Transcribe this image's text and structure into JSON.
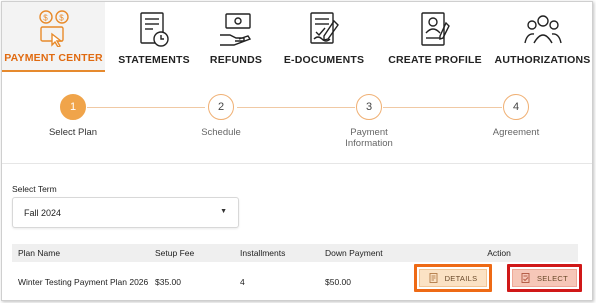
{
  "nav": {
    "items": [
      {
        "label": "PAYMENT CENTER",
        "icon": "payment-center-icon",
        "active": true
      },
      {
        "label": "STATEMENTS",
        "icon": "statements-icon"
      },
      {
        "label": "REFUNDS",
        "icon": "refunds-icon"
      },
      {
        "label": "E-DOCUMENTS",
        "icon": "e-documents-icon"
      },
      {
        "label": "CREATE PROFILE",
        "icon": "create-profile-icon"
      },
      {
        "label": "AUTHORIZATIONS",
        "icon": "authorizations-icon"
      }
    ]
  },
  "stepper": {
    "steps": [
      {
        "number": "1",
        "label": "Select Plan",
        "active": true
      },
      {
        "number": "2",
        "label": "Schedule"
      },
      {
        "number": "3",
        "label": "Payment Information"
      },
      {
        "number": "4",
        "label": "Agreement"
      }
    ]
  },
  "term": {
    "label": "Select Term",
    "selected": "Fall 2024"
  },
  "table": {
    "headers": [
      "Plan Name",
      "Setup Fee",
      "Installments",
      "Down Payment",
      "Action"
    ],
    "rows": [
      {
        "plan_name": "Winter Testing Payment Plan 2026",
        "setup_fee": "$35.00",
        "installments": "4",
        "down_payment": "$50.00"
      }
    ],
    "details_label": "DETAILS",
    "select_label": "SELECT"
  },
  "colors": {
    "accent": "#e06a10",
    "details_highlight": "#ee6a15",
    "select_highlight": "#d01818"
  }
}
